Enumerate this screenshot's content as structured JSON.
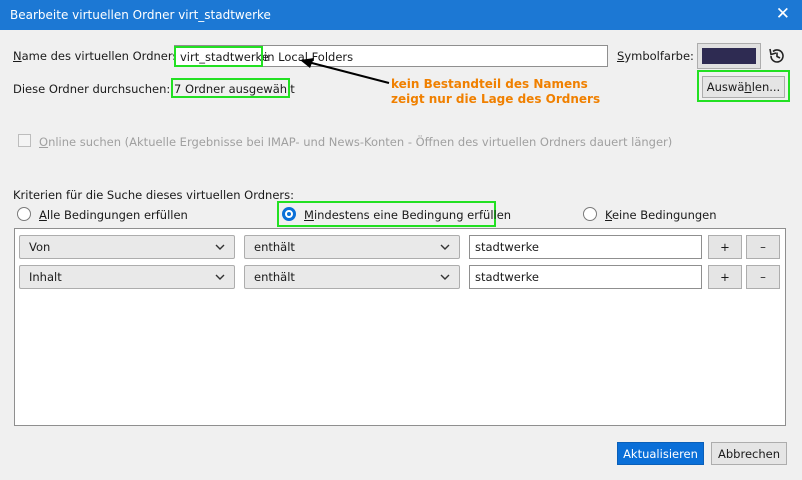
{
  "window": {
    "title": "Bearbeite virtuellen Ordner virt_stadtwerke",
    "close_glyph": "✕"
  },
  "folder_name": {
    "label_first": "N",
    "label_rest": "ame des virtuellen Ordners:",
    "value": "virt_stadtwerke",
    "suffix": "in Local Folders"
  },
  "symbol_color": {
    "label_pre": "S",
    "label_rest": "ymbolfarbe:",
    "value": "#2e2b52",
    "reset_icon": "history-icon"
  },
  "search_folders": {
    "label": "Diese Ordner durchsuchen:",
    "value": "7 Ordner ausgewählt",
    "button_pre": "Auswä",
    "button_u": "h",
    "button_post": "len..."
  },
  "annotation": {
    "line1": "kein Bestandteil des Namens",
    "line2": "zeigt nur die Lage des Ordners",
    "color": "#f08000"
  },
  "online_search": {
    "u": "O",
    "rest": "nline suchen (Aktuelle Ergebnisse bei IMAP- und News-Konten - Öffnen des virtuellen Ordners dauert länger)",
    "checked": false
  },
  "criteria": {
    "label": "Kriterien für die Suche dieses virtuellen Ordners:",
    "options": [
      {
        "u": "A",
        "rest": "lle Bedingungen erfüllen",
        "selected": false
      },
      {
        "u": "M",
        "rest": "indestens eine Bedingung erfüllen",
        "selected": true
      },
      {
        "u": "K",
        "rest": "eine Bedingungen",
        "selected": false
      }
    ]
  },
  "rules": [
    {
      "field": "Von",
      "operator": "enthält",
      "value": "stadtwerke",
      "add": "+",
      "remove": "–"
    },
    {
      "field": "Inhalt",
      "operator": "enthält",
      "value": "stadtwerke",
      "add": "+",
      "remove": "–"
    }
  ],
  "footer": {
    "update": "Aktualisieren",
    "cancel": "Abbrechen"
  },
  "colors": {
    "accent": "#1c78d4",
    "highlight": "#22e022"
  }
}
